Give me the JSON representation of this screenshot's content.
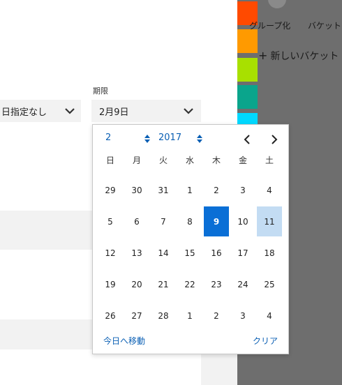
{
  "board": {
    "swatch_colors": [
      "#ff4a00",
      "#ff9a00",
      "#a8e000",
      "#0aa58c",
      "#00d8ff"
    ],
    "group_label": "グループ化",
    "bucket_label": "バケット",
    "new_bucket": "新しいバケット"
  },
  "form": {
    "left_select_value": "日指定なし",
    "due_label": "期限",
    "due_value": "2月9日"
  },
  "calendar": {
    "month": "2",
    "year": "2017",
    "weekdays": [
      "日",
      "月",
      "火",
      "水",
      "木",
      "金",
      "土"
    ],
    "weeks": [
      [
        "29",
        "30",
        "31",
        "1",
        "2",
        "3",
        "4"
      ],
      [
        "5",
        "6",
        "7",
        "8",
        "9",
        "10",
        "11"
      ],
      [
        "12",
        "13",
        "14",
        "15",
        "16",
        "17",
        "18"
      ],
      [
        "19",
        "20",
        "21",
        "22",
        "23",
        "24",
        "25"
      ],
      [
        "26",
        "27",
        "28",
        "1",
        "2",
        "3",
        "4"
      ]
    ],
    "selected_day": "9",
    "highlighted_day": "11",
    "today_link": "今日へ移動",
    "clear_link": "クリア"
  }
}
